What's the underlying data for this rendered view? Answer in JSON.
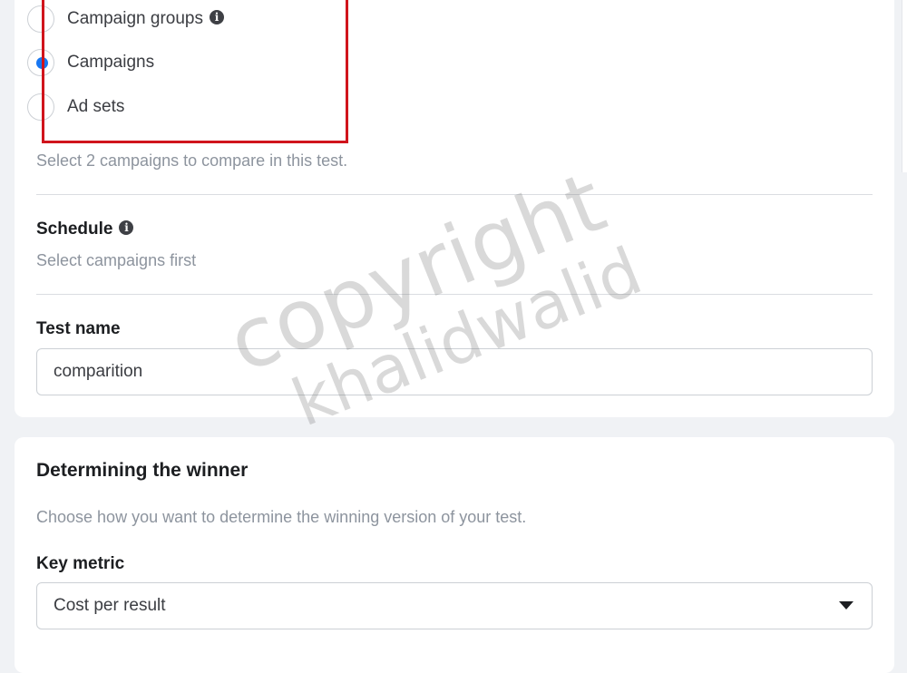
{
  "comparison": {
    "options": [
      {
        "label": "Campaign groups",
        "selected": false,
        "has_info": true
      },
      {
        "label": "Campaigns",
        "selected": true,
        "has_info": false
      },
      {
        "label": "Ad sets",
        "selected": false,
        "has_info": false
      }
    ],
    "help_text": "Select 2 campaigns to compare in this test.",
    "highlight_color": "#d0141c",
    "selected_color": "#1877f2"
  },
  "schedule": {
    "label": "Schedule",
    "help_text": "Select campaigns first"
  },
  "test_name": {
    "label": "Test name",
    "value": "comparition"
  },
  "winner": {
    "title": "Determining the winner",
    "description": "Choose how you want to determine the winning version of your test.",
    "key_metric_label": "Key metric",
    "key_metric_value": "Cost per result"
  },
  "icons": {
    "info": "info-icon",
    "dropdown": "caret-down-icon"
  },
  "watermark": {
    "line1": "copyright",
    "line2": "khalidwalid"
  }
}
